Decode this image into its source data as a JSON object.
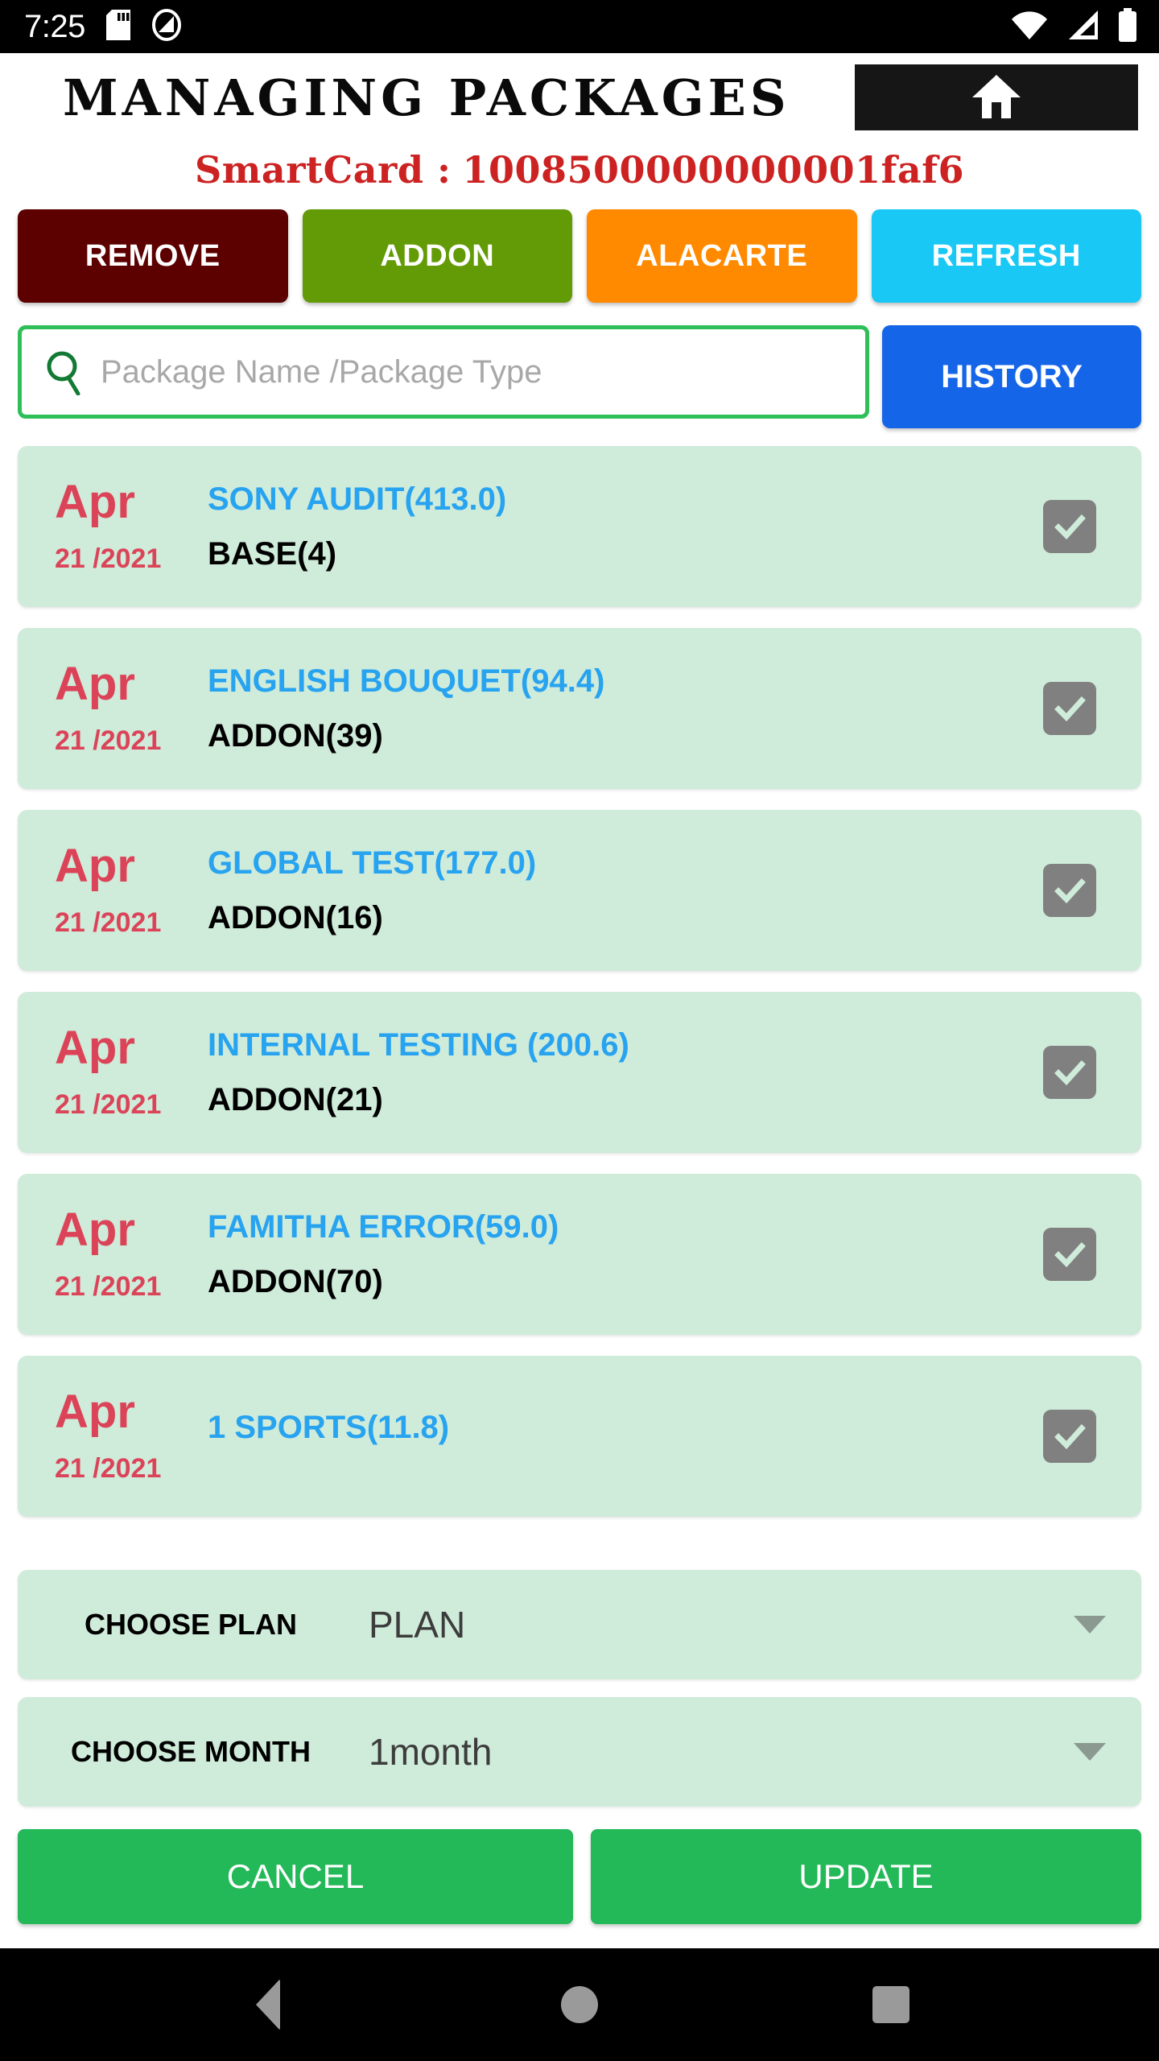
{
  "status_bar": {
    "clock": "7:25",
    "icons_left": [
      "sd-card-icon",
      "do-not-disturb-icon"
    ],
    "icons_right": [
      "wifi-icon",
      "cell-signal-icon",
      "battery-full-icon"
    ]
  },
  "header": {
    "title": "MANAGING PACKAGES",
    "home_icon": "home-icon",
    "smartcard_label": "SmartCard :",
    "smartcard_value": "1008500000000001faf6",
    "smartcard_color": "#CC2222"
  },
  "actions": [
    {
      "label": "REMOVE",
      "color": "#5C0000"
    },
    {
      "label": "ADDON",
      "color": "#639B06"
    },
    {
      "label": "ALACARTE",
      "color": "#FF8A00"
    },
    {
      "label": "REFRESH",
      "color": "#19C8F5"
    }
  ],
  "search": {
    "placeholder": "Package Name /Package Type",
    "value": "",
    "icon": "search-icon",
    "border_color": "#2FBF58"
  },
  "history_button": {
    "label": "HISTORY",
    "color": "#1565E8"
  },
  "packages": [
    {
      "month": "Apr",
      "day_year": "21 /2021",
      "name": "SONY AUDIT(413.0)",
      "type": "BASE(4)",
      "checked": true
    },
    {
      "month": "Apr",
      "day_year": "21 /2021",
      "name": "ENGLISH BOUQUET(94.4)",
      "type": "ADDON(39)",
      "checked": true
    },
    {
      "month": "Apr",
      "day_year": "21 /2021",
      "name": "GLOBAL TEST(177.0)",
      "type": "ADDON(16)",
      "checked": true
    },
    {
      "month": "Apr",
      "day_year": "21 /2021",
      "name": "INTERNAL TESTING (200.6)",
      "type": "ADDON(21)",
      "checked": true
    },
    {
      "month": "Apr",
      "day_year": "21 /2021",
      "name": "FAMITHA ERROR(59.0)",
      "type": "ADDON(70)",
      "checked": true
    },
    {
      "month": "Apr",
      "day_year": "21 /2021",
      "name": "1 SPORTS(11.8)",
      "type": "",
      "checked": true
    }
  ],
  "card_colors": {
    "background": "#CFEBDA",
    "date": "#DB4458",
    "name": "#27A3F0",
    "type": "#000000",
    "checkbox": "#808080"
  },
  "plan_select": {
    "label": "CHOOSE PLAN",
    "value": "PLAN",
    "caret": "chevron-down-icon"
  },
  "month_select": {
    "label": "CHOOSE MONTH",
    "value": "1month",
    "caret": "chevron-down-icon"
  },
  "confirm": {
    "cancel_label": "CANCEL",
    "update_label": "UPDATE",
    "color": "#23B858"
  },
  "nav_bar": {
    "back": "back-triangle-icon",
    "home": "home-circle-icon",
    "recent": "recents-square-icon"
  }
}
